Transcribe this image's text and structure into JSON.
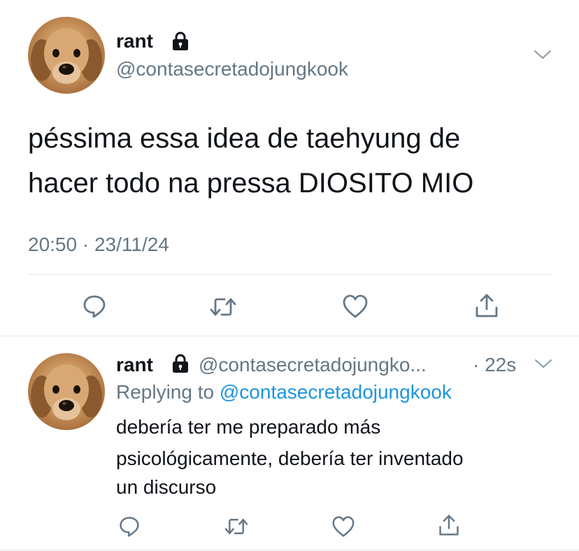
{
  "main_tweet": {
    "display_name": "rant",
    "handle": "@contasecretadojungkook",
    "text_line1": "péssima essa idea de taehyung de",
    "text_line2": "hacer todo na pressa DIOSITO MIO",
    "timestamp": "20:50 · 23/11/24"
  },
  "reply_tweet": {
    "display_name": "rant",
    "handle": "@contasecretadojungko...",
    "age": "· 22s",
    "replying_prefix": "Replying to",
    "replying_handle": "@contasecretadojungkook",
    "text_line1": "debería ter me preparado más",
    "text_line2": "psicológicamente, debería ter inventado",
    "text_line3": "un discurso"
  },
  "icons": {
    "lock": "lock-icon",
    "more": "chevron-down-icon",
    "reply": "reply-icon",
    "retweet": "retweet-icon",
    "like": "like-icon",
    "share": "share-icon"
  },
  "colors": {
    "text": "#0f1419",
    "secondary": "#657786",
    "link": "#1b95e0",
    "divider": "#e1e8ed"
  }
}
